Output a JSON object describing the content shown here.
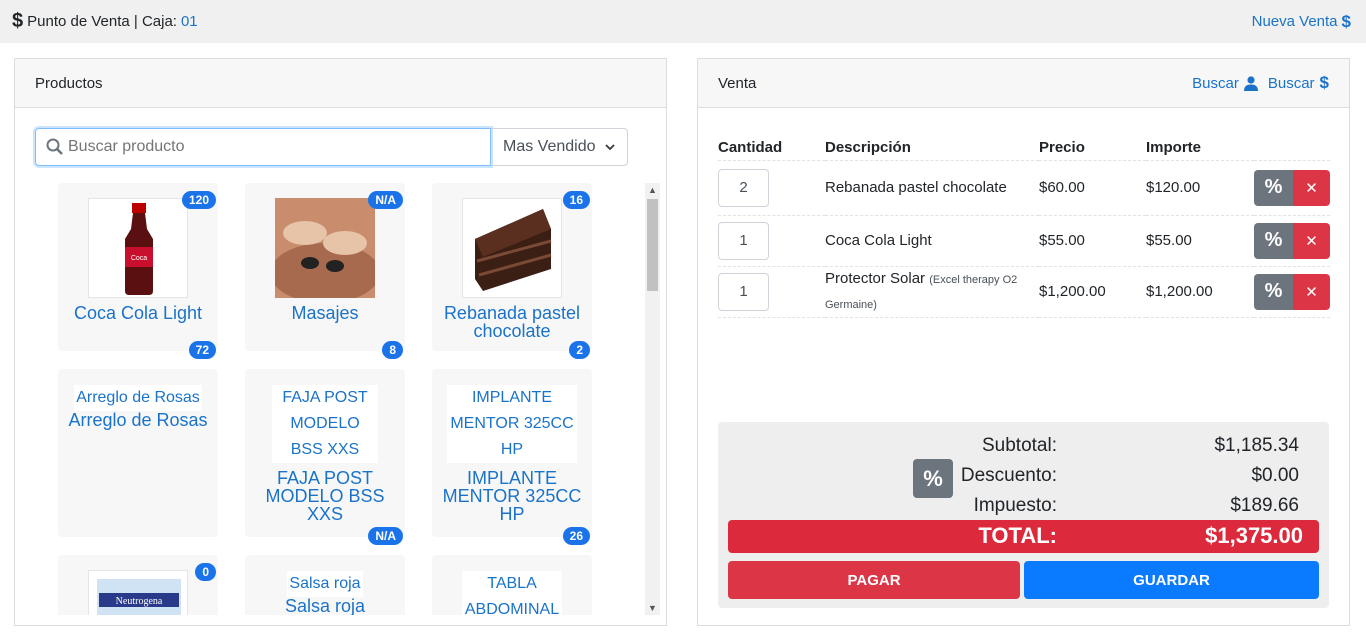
{
  "header": {
    "title": "Punto de Venta | Caja:",
    "caja": "01",
    "new_sale": "Nueva Venta"
  },
  "productos": {
    "title": "Productos",
    "search_placeholder": "Buscar producto",
    "sort_selected": "Mas Vendido",
    "tiles": [
      {
        "name": "Coca Cola Light",
        "badge_top": "120",
        "badge_bottom": "72"
      },
      {
        "name": "Masajes",
        "badge_top": "N/A",
        "badge_bottom": "8"
      },
      {
        "name": "Rebanada pastel chocolate",
        "badge_top": "16",
        "badge_bottom": "2"
      },
      {
        "name": "Arreglo de Rosas",
        "alt": "Arreglo de Rosas"
      },
      {
        "name": "FAJA POST MODELO BSS XXS",
        "alt": "FAJA POST MODELO BSS XXS",
        "badge_bottom": "N/A"
      },
      {
        "name": "IMPLANTE MENTOR 325CC HP",
        "alt": "IMPLANTE MENTOR 325CC HP",
        "badge_bottom": "26"
      },
      {
        "name": "",
        "badge_top": "0",
        "image_text": "Neutrogena"
      },
      {
        "name": "Salsa roja",
        "alt": "Salsa roja"
      },
      {
        "name": "",
        "alt": "TABLA ABDOMINAL"
      }
    ]
  },
  "venta": {
    "title": "Venta",
    "search_client": "Buscar",
    "search_sale": "Buscar",
    "columns": [
      "Cantidad",
      "Descripción",
      "Precio",
      "Importe"
    ],
    "rows": [
      {
        "qty": "2",
        "desc": "Rebanada pastel chocolate",
        "note": "",
        "price": "$60.00",
        "amount": "$120.00"
      },
      {
        "qty": "1",
        "desc": "Coca Cola Light",
        "note": "",
        "price": "$55.00",
        "amount": "$55.00"
      },
      {
        "qty": "1",
        "desc": "Protector Solar",
        "note": "(Excel therapy O2 Germaine)",
        "price": "$1,200.00",
        "amount": "$1,200.00"
      }
    ],
    "subtotal_label": "Subtotal:",
    "subtotal": "$1,185.34",
    "discount_label": "Descuento:",
    "discount": "$0.00",
    "tax_label": "Impuesto:",
    "tax": "$189.66",
    "total_label": "TOTAL:",
    "total": "$1,375.00",
    "pay_label": "PAGAR",
    "save_label": "GUARDAR"
  }
}
